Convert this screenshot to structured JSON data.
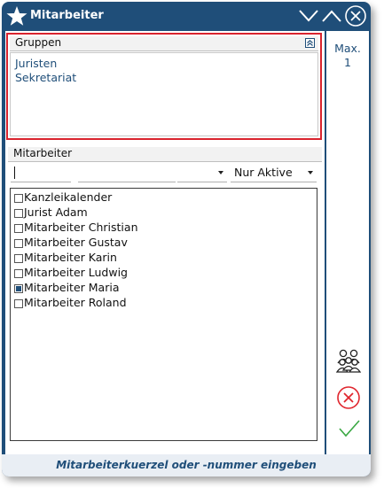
{
  "window": {
    "title": "Mitarbeiter",
    "footer_hint": "Mitarbeiterkuerzel oder -nummer eingeben"
  },
  "gruppen": {
    "header": "Gruppen",
    "items": [
      "Juristen",
      "Sekretariat"
    ]
  },
  "mitarbeiter": {
    "header": "Mitarbeiter",
    "filter1_value": "",
    "filter2_value": "",
    "status_select": "Nur Aktive",
    "items": [
      {
        "name": "Kanzleikalender",
        "checked": false
      },
      {
        "name": "Jurist Adam",
        "checked": false
      },
      {
        "name": "Mitarbeiter Christian",
        "checked": false
      },
      {
        "name": "Mitarbeiter Gustav",
        "checked": false
      },
      {
        "name": "Mitarbeiter Karin",
        "checked": false
      },
      {
        "name": "Mitarbeiter Ludwig",
        "checked": false
      },
      {
        "name": "Mitarbeiter Maria",
        "checked": true
      },
      {
        "name": "Mitarbeiter Roland",
        "checked": false
      }
    ]
  },
  "sidebar": {
    "max_label": "Max.",
    "max_value": "1",
    "icons": [
      "group-icon",
      "cancel-icon",
      "confirm-icon"
    ]
  },
  "colors": {
    "chrome": "#1f4e79",
    "highlight_border": "#d9232e",
    "cancel": "#e0262e",
    "confirm": "#3aa843"
  }
}
